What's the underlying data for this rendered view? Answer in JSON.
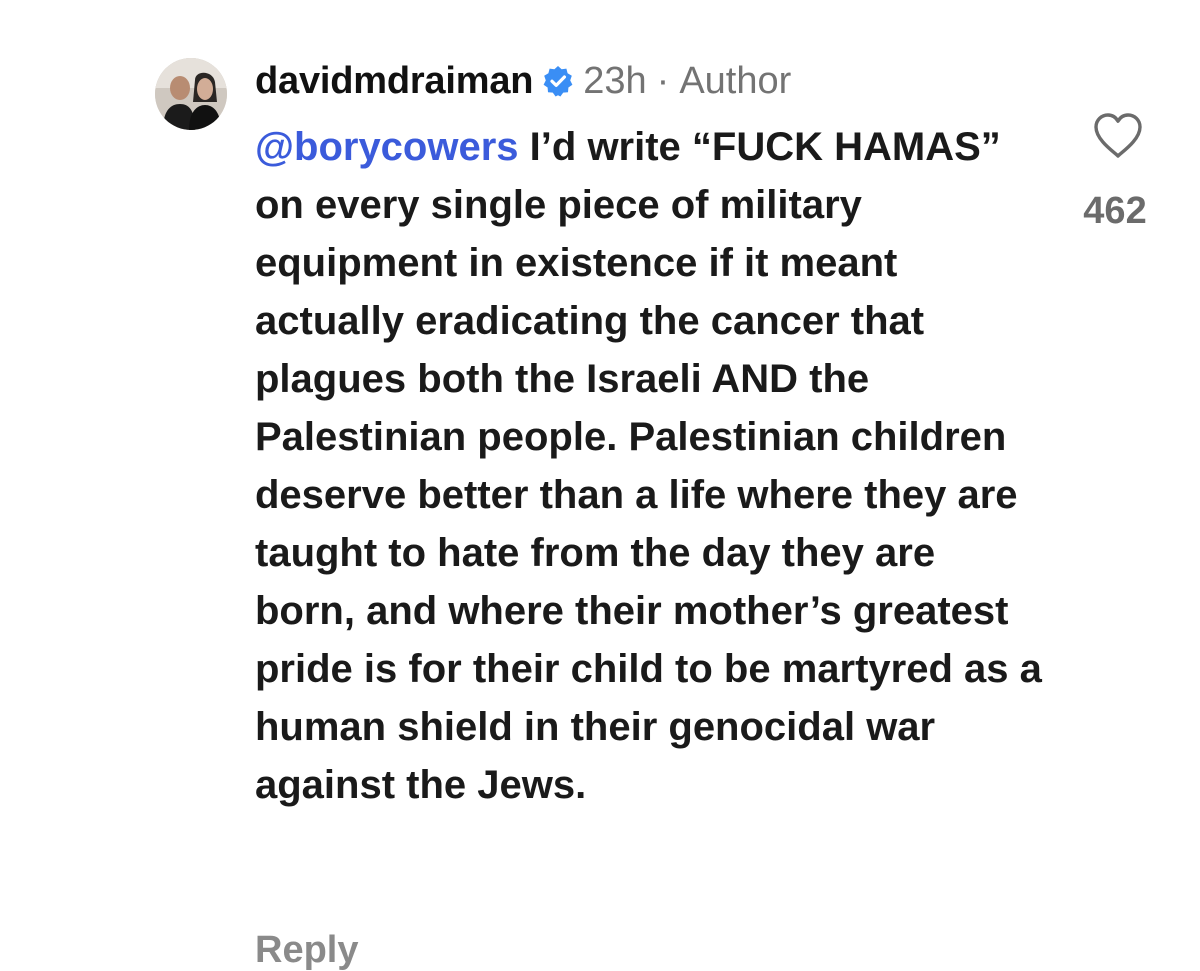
{
  "comment": {
    "username": "davidmdraiman",
    "verified": true,
    "verified_icon": "verified-badge-icon",
    "time": "23h",
    "separator": "·",
    "role": "Author",
    "mention": "@borycowers",
    "text": "I’d write “FUCK HAMAS” on every single piece of military equipment in existence if it meant actually eradicating the cancer that plagues both the Israeli AND the Palestinian people. Palestinian children deserve better than a life where they are taught to hate from the day they are born, and where their mother’s greatest pride is for their child to be martyred as a human shield in their genocidal war against the Jews.",
    "like_icon": "heart-outline-icon",
    "like_count": "462",
    "reply_label": "Reply"
  },
  "colors": {
    "mention": "#3b5bdb",
    "verified": "#3a8ef5",
    "meta": "#737373",
    "like_count": "#6b6b6b"
  }
}
